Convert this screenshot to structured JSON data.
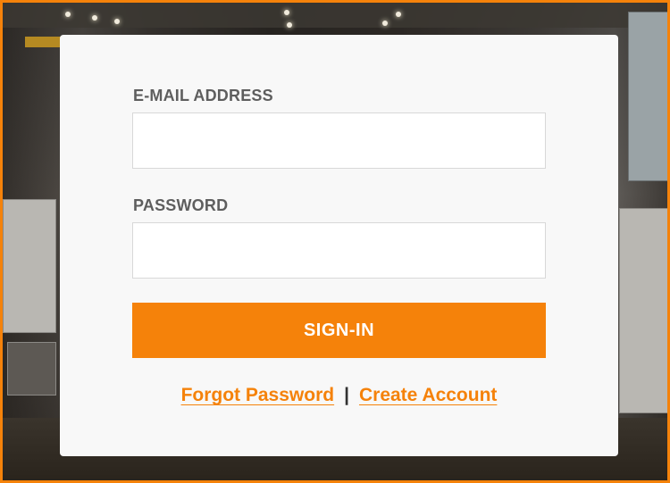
{
  "login": {
    "email_label": "E-MAIL ADDRESS",
    "email_value": "",
    "password_label": "PASSWORD",
    "password_value": "",
    "signin_label": "SIGN-IN",
    "forgot_label": "Forgot Password",
    "separator": "|",
    "create_label": "Create Account"
  },
  "colors": {
    "accent": "#f5820a",
    "card": "#f8f8f8",
    "label": "#5e5e5e"
  }
}
